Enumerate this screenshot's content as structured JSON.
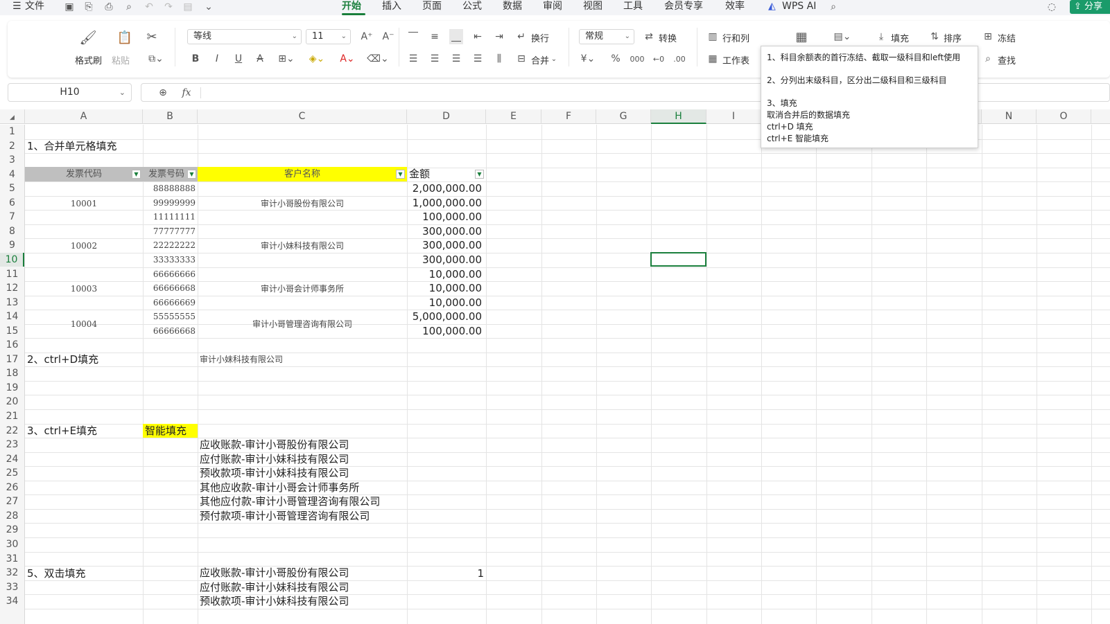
{
  "menubar": {
    "file": "文件",
    "tabs": [
      "开始",
      "插入",
      "页面",
      "公式",
      "数据",
      "审阅",
      "视图",
      "工具",
      "会员专享",
      "效率"
    ],
    "wps_ai": "WPS AI",
    "share": "分享"
  },
  "ribbon": {
    "format_painter": "格式刷",
    "paste": "粘贴",
    "font_name": "等线",
    "font_size": "11",
    "wrap": "换行",
    "merge": "合并",
    "number_format": "常规",
    "convert": "转换",
    "rows_cols": "行和列",
    "worksheet": "工作表",
    "fill": "填充",
    "sort": "排序",
    "freeze": "冻结",
    "find": "查找",
    "currency": "¥",
    "percent": "%",
    "thousands": "000"
  },
  "formula": {
    "name_box": "H10",
    "fx": "fx",
    "value": ""
  },
  "columns": [
    "A",
    "B",
    "C",
    "D",
    "E",
    "F",
    "G",
    "H",
    "I",
    "N",
    "O"
  ],
  "rows": [
    "1",
    "2",
    "3",
    "4",
    "5",
    "6",
    "7",
    "8",
    "9",
    "10",
    "11",
    "12",
    "13",
    "14",
    "15",
    "16",
    "17",
    "18",
    "19",
    "20",
    "21",
    "22",
    "23",
    "24",
    "25",
    "26",
    "27",
    "28",
    "29",
    "30",
    "31",
    "32",
    "33",
    "34"
  ],
  "sheet": {
    "section1": "1、合并单元格填充",
    "headers": [
      "发票代码",
      "发票号码",
      "客户名称",
      "金额"
    ],
    "codes": [
      "10001",
      "10002",
      "10003",
      "10004"
    ],
    "numbers": [
      "88888888",
      "99999999",
      "11111111",
      "77777777",
      "22222222",
      "33333333",
      "66666666",
      "66666668",
      "66666669",
      "55555555",
      "66666668"
    ],
    "customers": [
      "审计小哥股份有限公司",
      "审计小妹科技有限公司",
      "审计小哥会计师事务所",
      "审计小哥管理咨询有限公司"
    ],
    "amounts": [
      "2,000,000.00",
      "1,000,000.00",
      "100,000.00",
      "300,000.00",
      "300,000.00",
      "300,000.00",
      "10,000.00",
      "10,000.00",
      "10,000.00",
      "5,000,000.00",
      "100,000.00"
    ],
    "section2": "2、ctrl+D填充",
    "ctrl_d_value": "审计小妹科技有限公司",
    "section3": "3、ctrl+E填充",
    "smart_fill": "智能填充",
    "ctrl_e_list": [
      "应收账款-审计小哥股份有限公司",
      "应付账款-审计小妹科技有限公司",
      "预收款项-审计小妹科技有限公司",
      "其他应收款-审计小哥会计师事务所",
      "其他应付款-审计小哥管理咨询有限公司",
      "预付款项-审计小哥管理咨询有限公司"
    ],
    "section5": "5、双击填充",
    "dbl_list": [
      "应收账款-审计小哥股份有限公司",
      "应付账款-审计小妹科技有限公司",
      "预收款项-审计小妹科技有限公司"
    ],
    "dbl_value": "1"
  },
  "tooltip": {
    "line1": "1、科目余额表的首行冻结、截取一级科目和left使用",
    "line2": "2、分列出末级科目，区分出二级科目和三级科目",
    "line3": "3、填充",
    "line4": "取消合并后的数据填充",
    "line5": "ctrl+D 填充",
    "line6": "ctrl+E  智能填充"
  },
  "colors": {
    "accent": "#1a7f3c",
    "header_yellow": "#ffff00",
    "header_gray": "#bfbfbf"
  }
}
